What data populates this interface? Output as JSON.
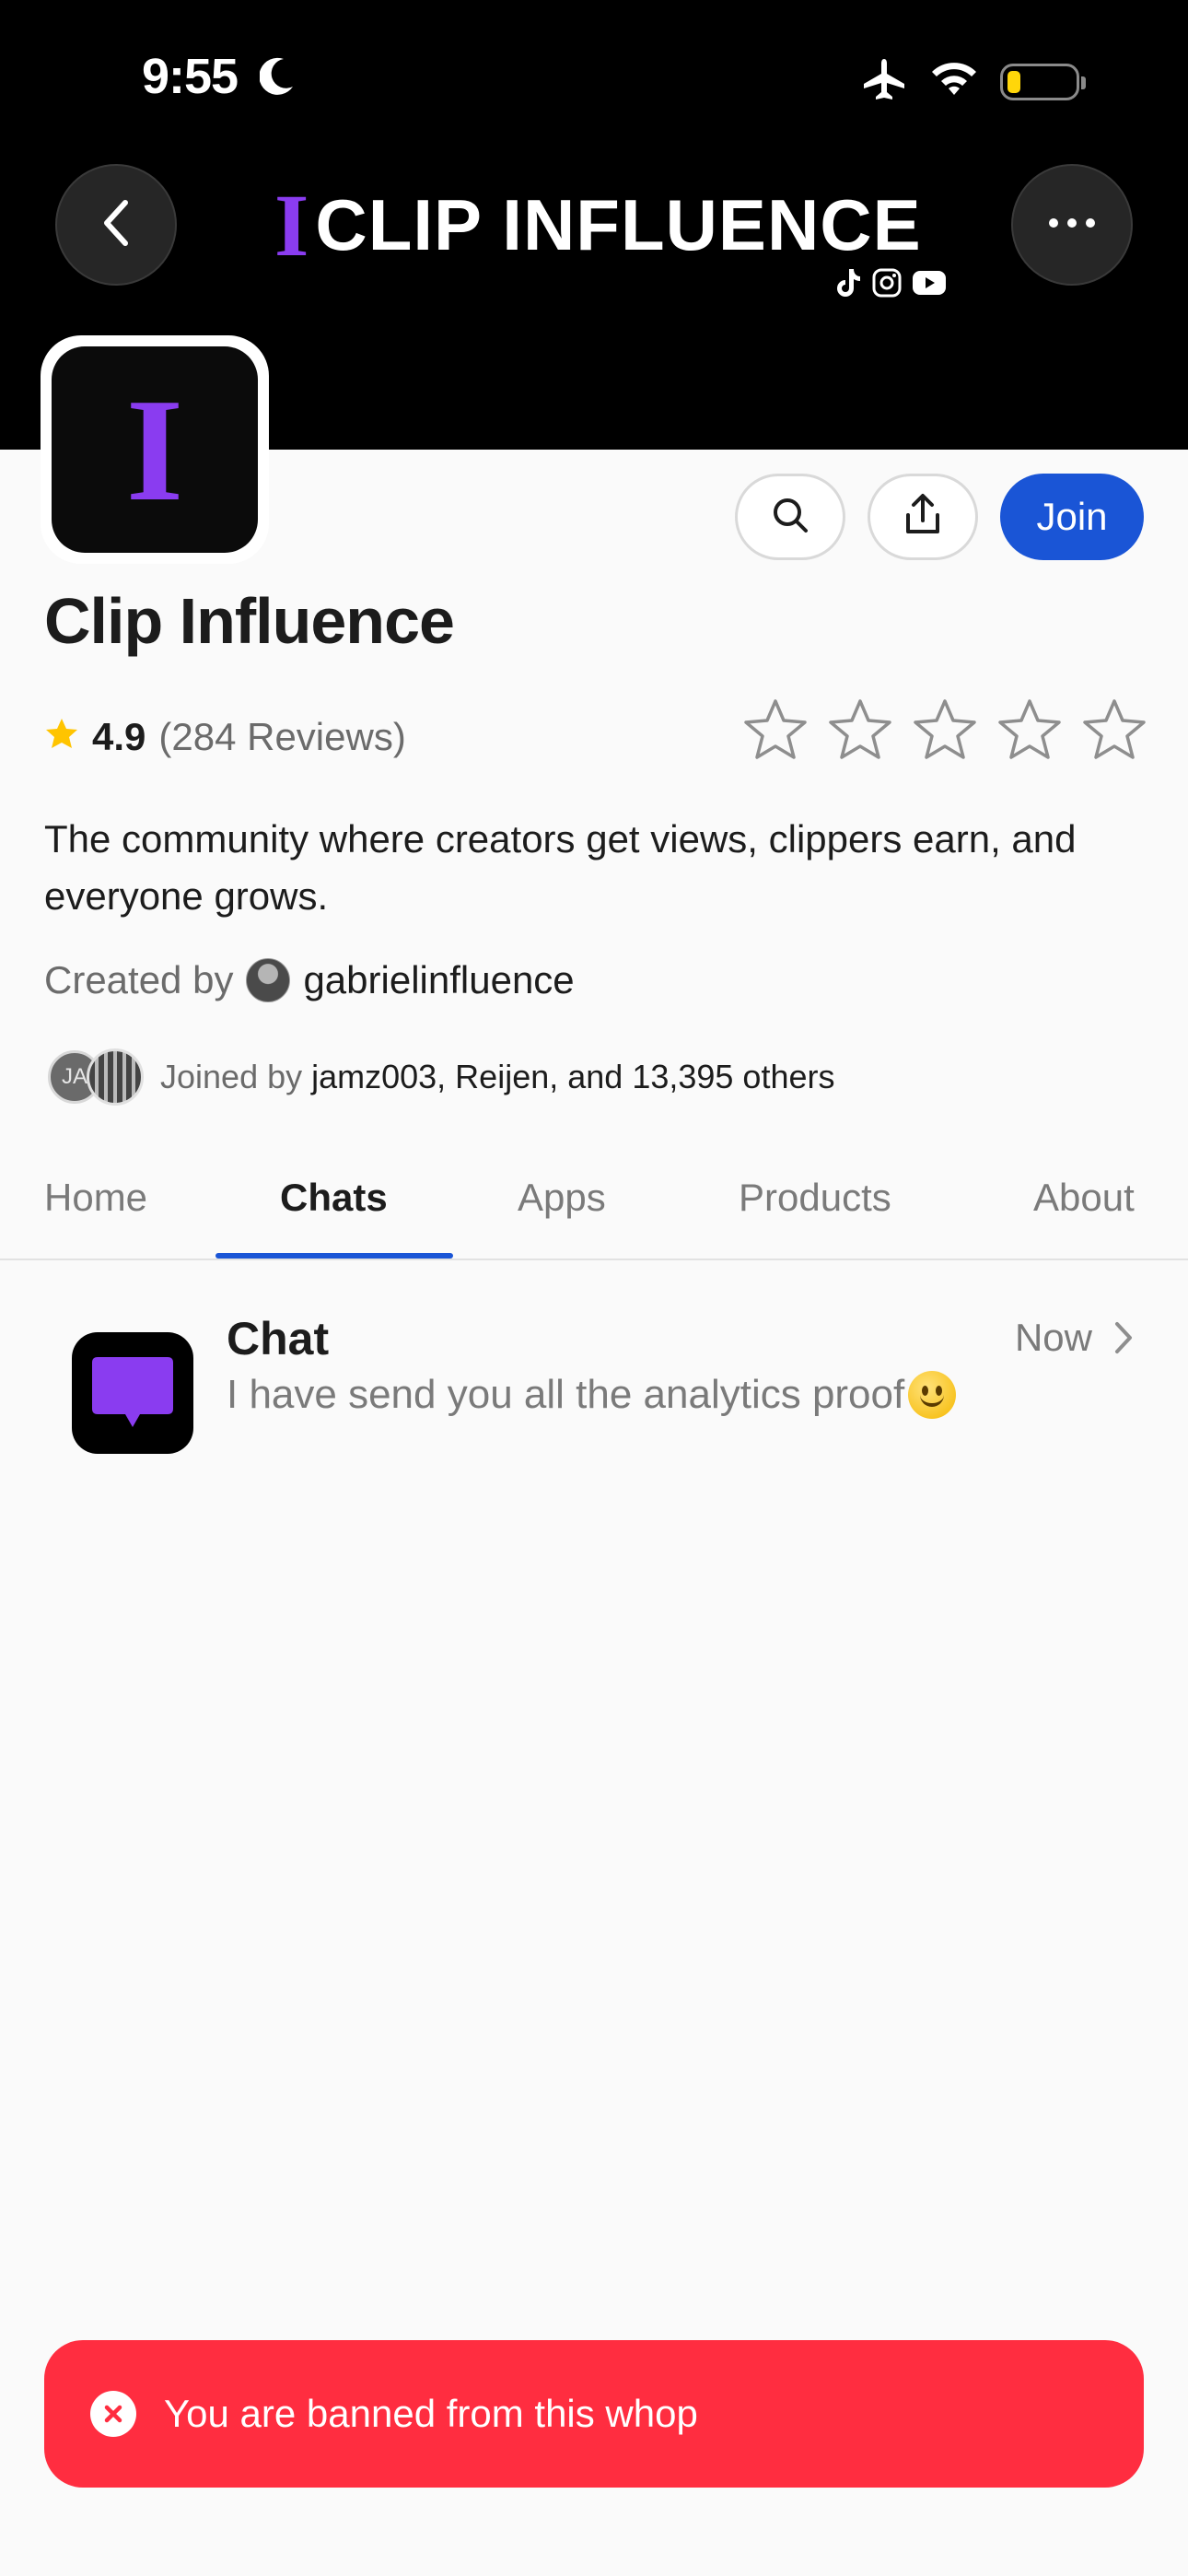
{
  "status_bar": {
    "time": "9:55",
    "icons": [
      "moon-icon",
      "airplane-icon",
      "wifi-icon",
      "battery-icon"
    ]
  },
  "header": {
    "banner_title": "CLIP INFLUENCE",
    "banner_title_prefix": "I",
    "logo_letter": "I",
    "socials": [
      "tiktok-icon",
      "instagram-icon",
      "youtube-icon"
    ],
    "accent_color": "#8a3cf0"
  },
  "actions": {
    "join_label": "Join",
    "join_color": "#1a55d6"
  },
  "community": {
    "name": "Clip Influence",
    "rating": "4.9",
    "reviews": "(284 Reviews)",
    "star_count": 5,
    "description": "The community where creators get views, clippers earn, and everyone grows.",
    "created_by_label": "Created by",
    "creator": "gabrielinfluence",
    "joined_label": "Joined by",
    "joined_names": "jamz003, Reijen, and 13,395 others",
    "member_initials": "JA"
  },
  "tabs": [
    {
      "label": "Home",
      "active": false
    },
    {
      "label": "Chats",
      "active": true
    },
    {
      "label": "Apps",
      "active": false
    },
    {
      "label": "Products",
      "active": false
    },
    {
      "label": "About",
      "active": false
    }
  ],
  "chat": {
    "title": "Chat",
    "time": "Now",
    "message": "I have send you all the analytics proof"
  },
  "toast": {
    "message": "You are banned from this whop",
    "color": "#ff2d40"
  }
}
